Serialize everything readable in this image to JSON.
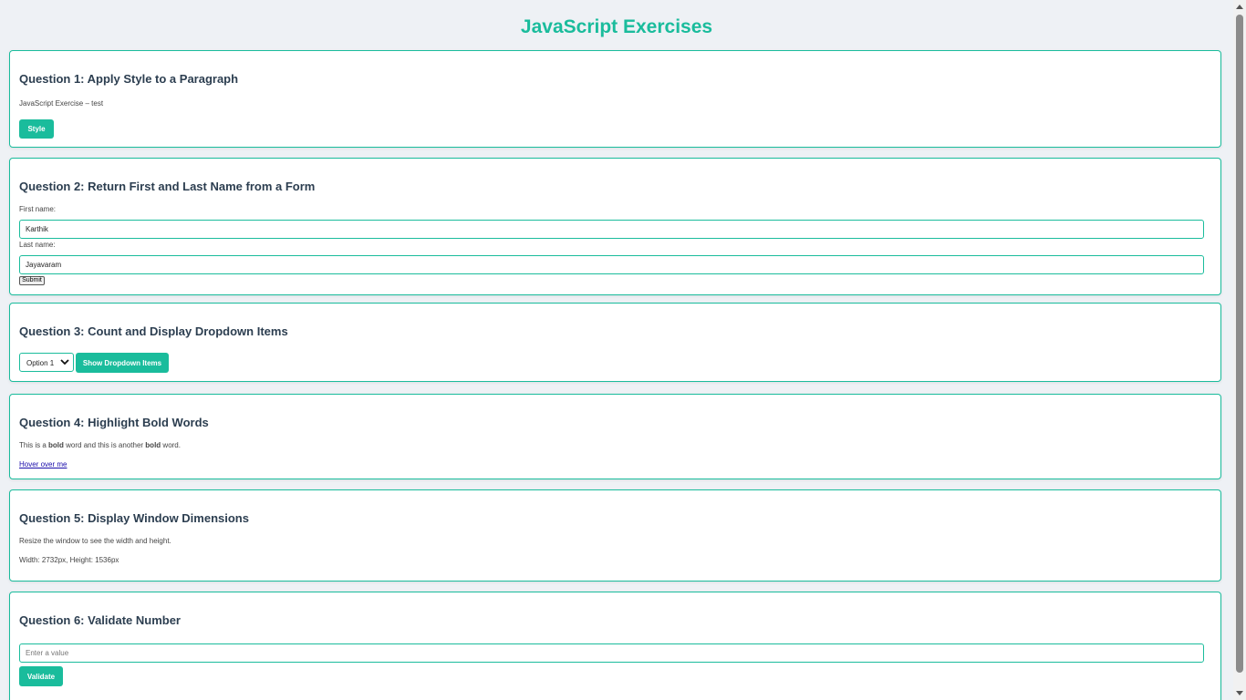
{
  "page": {
    "title": "JavaScript Exercises"
  },
  "q1": {
    "heading": "Question 1: Apply Style to a Paragraph",
    "paragraph": "JavaScript Exercise – test",
    "button": "Style"
  },
  "q2": {
    "heading": "Question 2: Return First and Last Name from a Form",
    "first_label": "First name:",
    "first_value": "Karthik",
    "last_label": "Last name:",
    "last_value": "Jayavaram",
    "submit": "Submit"
  },
  "q3": {
    "heading": "Question 3: Count and Display Dropdown Items",
    "selected": "Option 1",
    "button": "Show Dropdown Items"
  },
  "q4": {
    "heading": "Question 4: Highlight Bold Words",
    "text_1": "This is a ",
    "bold_1": "bold",
    "text_2": " word and this is another ",
    "bold_2": "bold",
    "text_3": " word.",
    "link": "Hover over me"
  },
  "q5": {
    "heading": "Question 5: Display Window Dimensions",
    "info": "Resize the window to see the width and height.",
    "dimensions": "Width: 2732px, Height: 1536px"
  },
  "q6": {
    "heading": "Question 6: Validate Number",
    "placeholder": "Enter a value",
    "button": "Validate"
  },
  "colors": {
    "accent": "#1abc9c",
    "heading": "#2c3e50",
    "background": "#eef1f5"
  }
}
